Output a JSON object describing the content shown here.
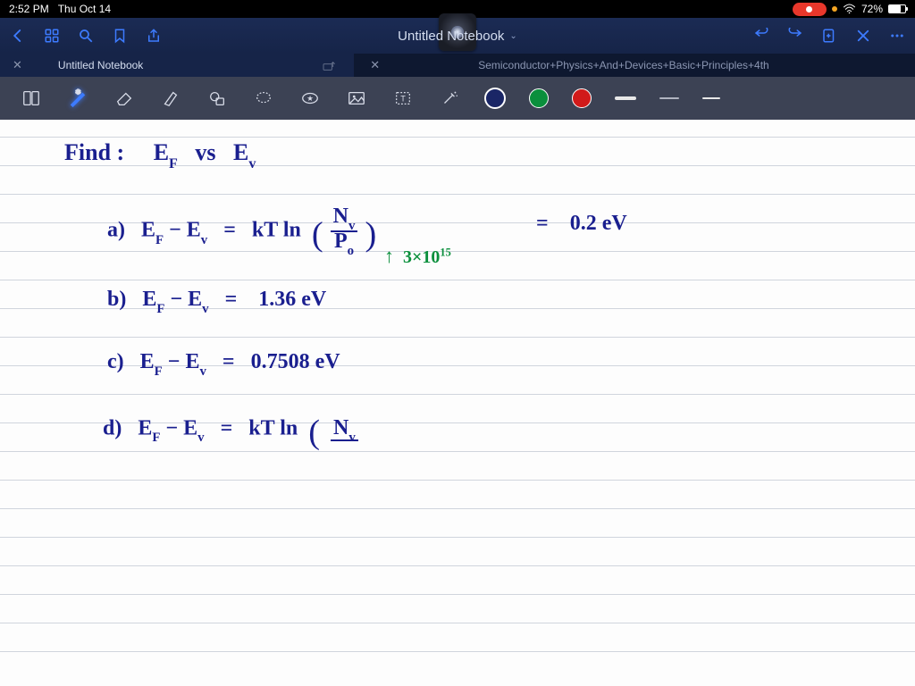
{
  "status": {
    "time": "2:52 PM",
    "date": "Thu Oct 14",
    "battery_pct": "72%",
    "wifi_signal": "•"
  },
  "titlebar": {
    "document_title": "Untitled Notebook"
  },
  "tabs": {
    "active": {
      "label": "Untitled Notebook"
    },
    "secondary": {
      "label": "Semiconductor+Physics+And+Devices+Basic+Principles+4th"
    }
  },
  "toolbar": {
    "colors": {
      "navy": "#1a2666",
      "green": "#0a8f3c",
      "red": "#d11a1a"
    }
  },
  "notes": {
    "heading": "Find :",
    "heading_expr_left": "E",
    "heading_sub1": "F",
    "heading_vs": "vs",
    "heading_sub2": "v",
    "a_label": "a)",
    "a_left": "E",
    "a_sub1": "F",
    "a_minus": " − E",
    "a_sub2": "v",
    "a_eq": "=",
    "a_kt": "kT ln",
    "a_frac_num": "N",
    "a_frac_num_sub": "v",
    "a_frac_den": "P",
    "a_frac_den_sub": "o",
    "a_val_eq": "=",
    "a_val": "0.2  eV",
    "a_annot_arrow": "↑",
    "a_annot": "3×10",
    "a_annot_sup": "15",
    "b_label": "b)",
    "b_expr": "E",
    "b_sub1": "F",
    "b_minus": " − E",
    "b_sub2": "v",
    "b_eq": "=",
    "b_val": "1.36   eV",
    "c_label": "c)",
    "c_expr": "E",
    "c_sub1": "F",
    "c_minus": " − E",
    "c_sub2": "v",
    "c_eq": "=",
    "c_val": "0.7508 eV",
    "d_label": "d)",
    "d_expr": "E",
    "d_sub1": "F",
    "d_minus": " − E",
    "d_sub2": "v",
    "d_eq": "=",
    "d_kt": "kT ln",
    "d_frac_num": "N",
    "d_frac_num_sub": "v"
  }
}
